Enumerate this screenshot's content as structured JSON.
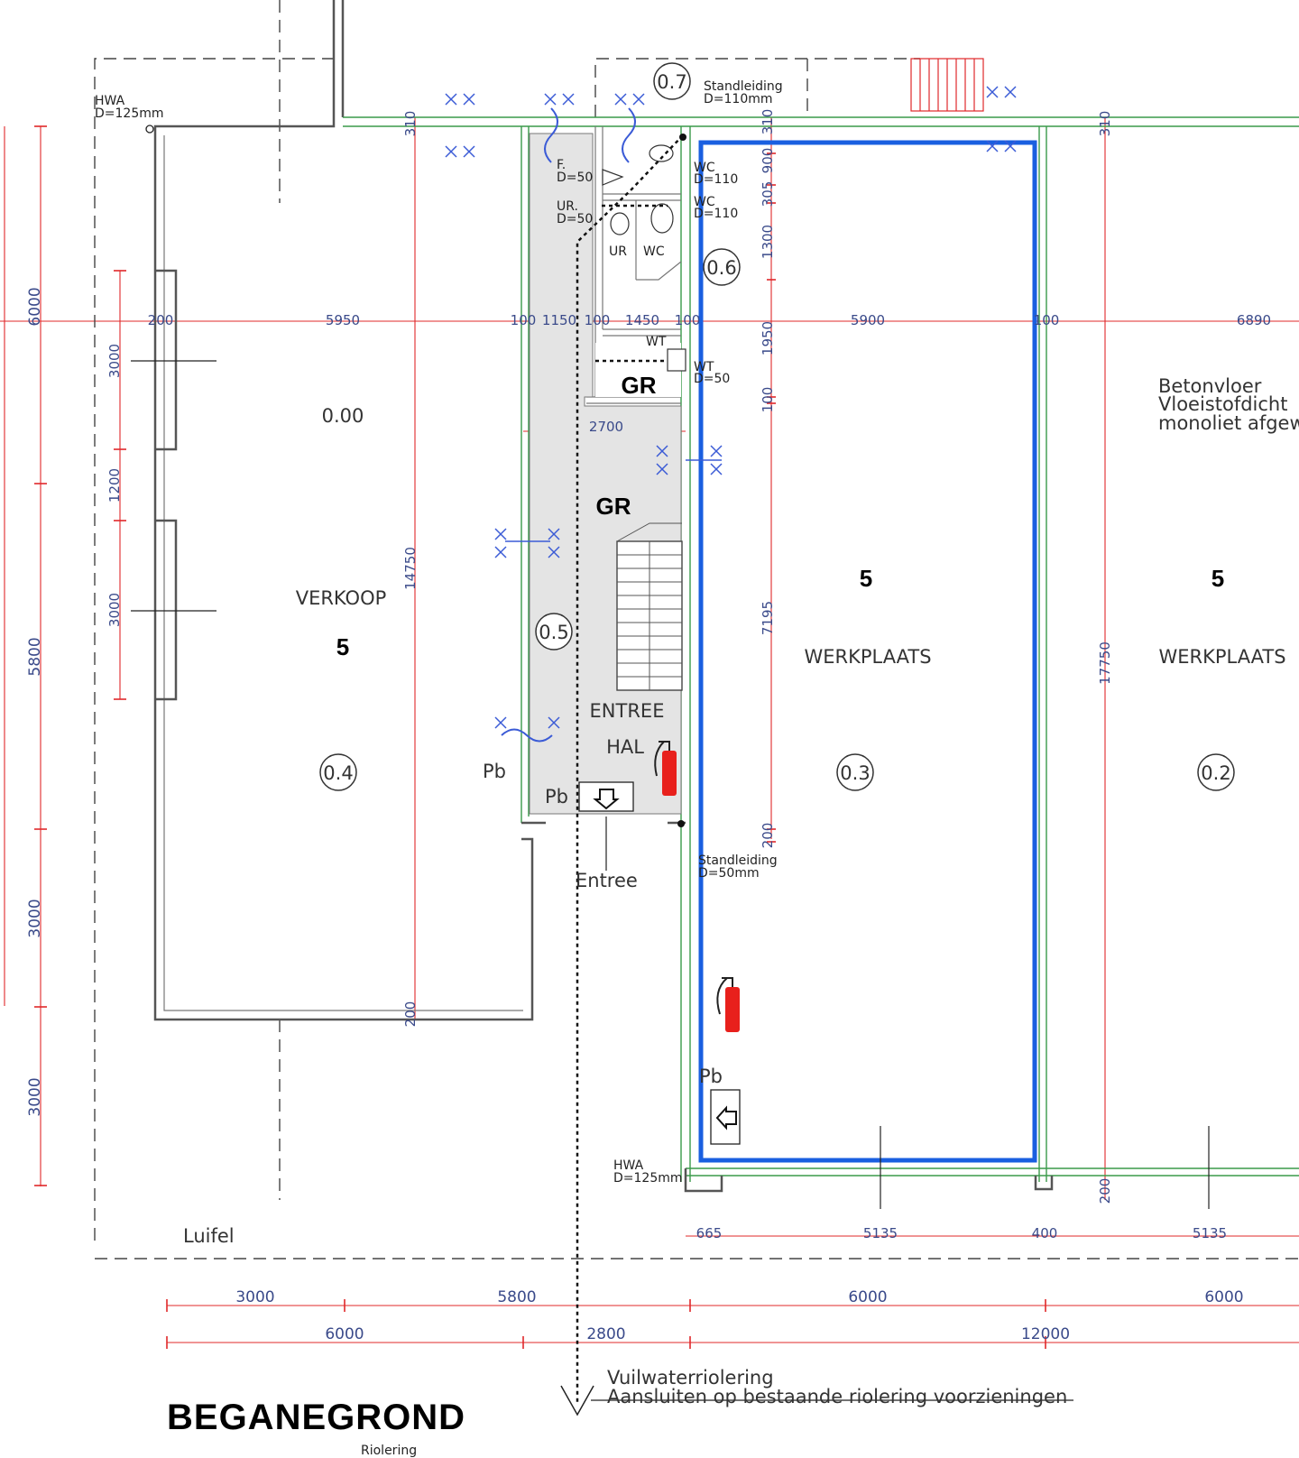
{
  "drawing": {
    "title": "BEGANEGROND",
    "subtitle": "Riolering",
    "canopy_label": "Luifel",
    "entrance_label": "Entree",
    "sewer_note_line1": "Vuilwaterriolering",
    "sewer_note_line2": "Aansluiten op bestaande riolering voorzieningen"
  },
  "rooms": [
    {
      "id": "0.4",
      "name": "VERKOOP",
      "number": "5",
      "level": "0.00"
    },
    {
      "id": "0.5",
      "name_line1": "ENTREE",
      "name_line2": "HAL",
      "code1": "GR",
      "code2": "GR"
    },
    {
      "id": "0.3",
      "name": "WERKPLAATS",
      "number": "5"
    },
    {
      "id": "0.2",
      "name": "WERKPLAATS",
      "number": "5"
    },
    {
      "id": "0.6",
      "label_ur": "UR",
      "label_wc": "WC"
    },
    {
      "id": "0.7"
    }
  ],
  "floor_note": {
    "line1": "Betonvloer",
    "line2": "Vloeistofdicht",
    "line3": "monoliet  afgew"
  },
  "pipes": {
    "hwa_top": {
      "line1": "HWA",
      "line2": "D=125mm"
    },
    "hwa_bottom": {
      "line1": "HWA",
      "line2": "D=125mm"
    },
    "standleiding_top": {
      "line1": "Standleiding",
      "line2": "D=110mm"
    },
    "standleiding_bottom": {
      "line1": "Standleiding",
      "line2": "D=50mm"
    },
    "fixtures": [
      {
        "label": "F.",
        "dia": "D=50"
      },
      {
        "label": "UR.",
        "dia": "D=50"
      },
      {
        "label": "WC",
        "dia": "D=110"
      },
      {
        "label": "WC",
        "dia": "D=110"
      },
      {
        "label": "WT",
        "dia": "D=50"
      },
      {
        "label": "WT",
        "dia": ""
      }
    ],
    "pb_label": "Pb"
  },
  "dimensions": {
    "left_vertical": [
      "6000",
      "5800",
      "3000",
      "3000"
    ],
    "left_window": [
      "3000",
      "1200",
      "3000"
    ],
    "overall_vertical": "14750",
    "right_vertical": "17750",
    "middle_vertical": [
      "900",
      "305",
      "1300",
      "1950",
      "100",
      "7195",
      "200"
    ],
    "wall_thickness": [
      "310",
      "310",
      "310"
    ],
    "bottom_thickness": [
      "200",
      "200"
    ],
    "top_row": [
      "200",
      "5950",
      "100",
      "1150",
      "100",
      "1450",
      "100",
      "5900",
      "100",
      "6890"
    ],
    "stair_width": "2700",
    "bottom_row1": [
      "665",
      "5135",
      "400",
      "5135"
    ],
    "grid_row1": [
      "3000",
      "5800",
      "6000",
      "6000"
    ],
    "grid_row2": [
      "6000",
      "2800",
      "12000"
    ]
  },
  "colors": {
    "highlight": "#1a5fe0",
    "dimension": "#3a4a8a",
    "grid": "#e0282a",
    "wall_finish": "#3a9a4a",
    "extinguisher": "#e8201c"
  }
}
